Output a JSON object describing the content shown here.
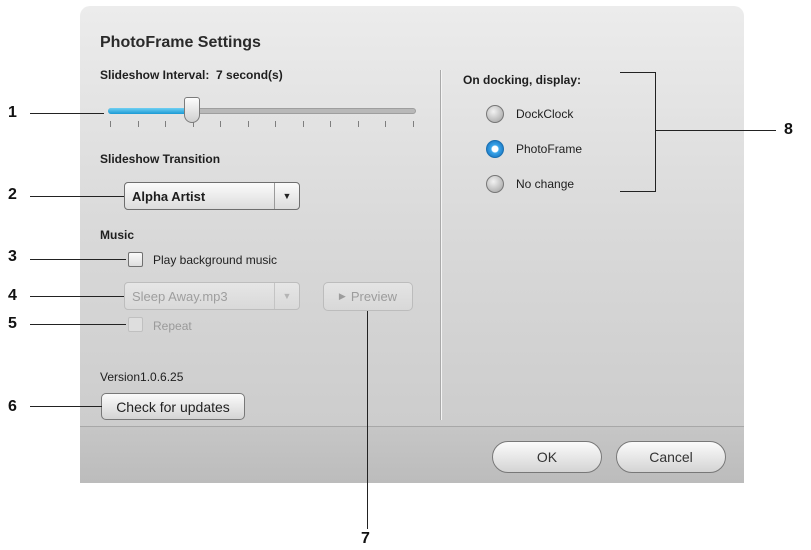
{
  "dialog": {
    "title": "PhotoFrame Settings",
    "interval_label": "Slideshow Interval:",
    "interval_value": "7 second(s)",
    "interval_seconds": 7,
    "transition_heading": "Slideshow Transition",
    "transition_selected": "Alpha Artist",
    "music_heading": "Music",
    "play_music_label": "Play background music",
    "play_music_checked": false,
    "music_file": "Sleep Away.mp3",
    "preview_label": "Preview",
    "repeat_label": "Repeat",
    "repeat_checked": false,
    "version_text": "Version1.0.6.25",
    "check_updates_label": "Check for updates",
    "docking_heading": "On docking, display:",
    "docking_options": [
      "DockClock",
      "PhotoFrame",
      "No change"
    ],
    "docking_selected": "PhotoFrame",
    "ok_label": "OK",
    "cancel_label": "Cancel"
  },
  "callouts": [
    "1",
    "2",
    "3",
    "4",
    "5",
    "6",
    "7",
    "8"
  ],
  "colors": {
    "accent": "#1b9ad4"
  },
  "icons": {
    "dropdown": "triangle-down-icon",
    "play": "play-icon"
  }
}
